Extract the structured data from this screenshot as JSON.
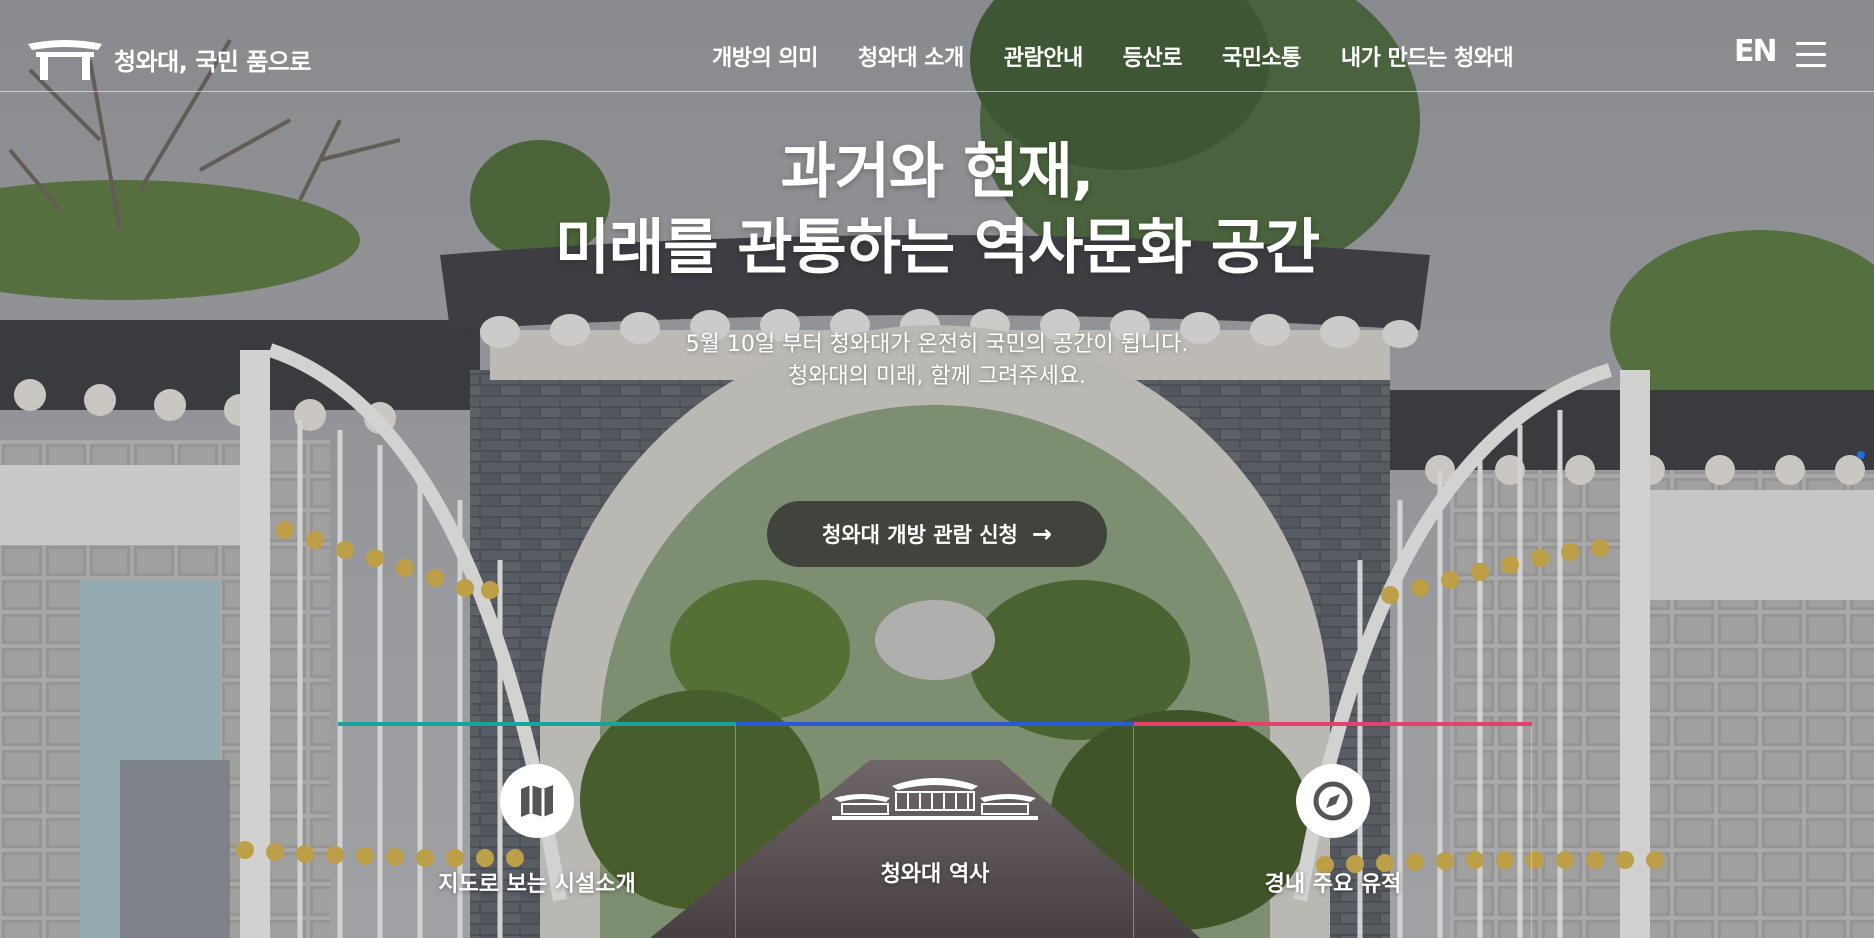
{
  "header": {
    "logo_text": "청와대, 국민 품으로",
    "nav": [
      "개방의 의미",
      "청와대 소개",
      "관람안내",
      "등산로",
      "국민소통",
      "내가 만드는 청와대"
    ],
    "lang": "EN"
  },
  "hero": {
    "title_line1": "과거와 현재,",
    "title_line2": "미래를 관통하는 역사문화 공간",
    "subtitle_line1": "5월 10일 부터 청와대가 온전히 국민의 공간이 됩니다.",
    "subtitle_line2": "청와대의 미래, 함께 그려주세요.",
    "cta_label": "청와대 개방 관람 신청"
  },
  "panels": [
    {
      "label": "지도로 보는 시설소개",
      "icon": "map-icon",
      "color": "#1aa39a"
    },
    {
      "label": "청와대 역사",
      "icon": "blue-house-icon",
      "color": "#2a5bd7"
    },
    {
      "label": "경내 주요 유적",
      "icon": "compass-icon",
      "color": "#e5416b"
    }
  ]
}
